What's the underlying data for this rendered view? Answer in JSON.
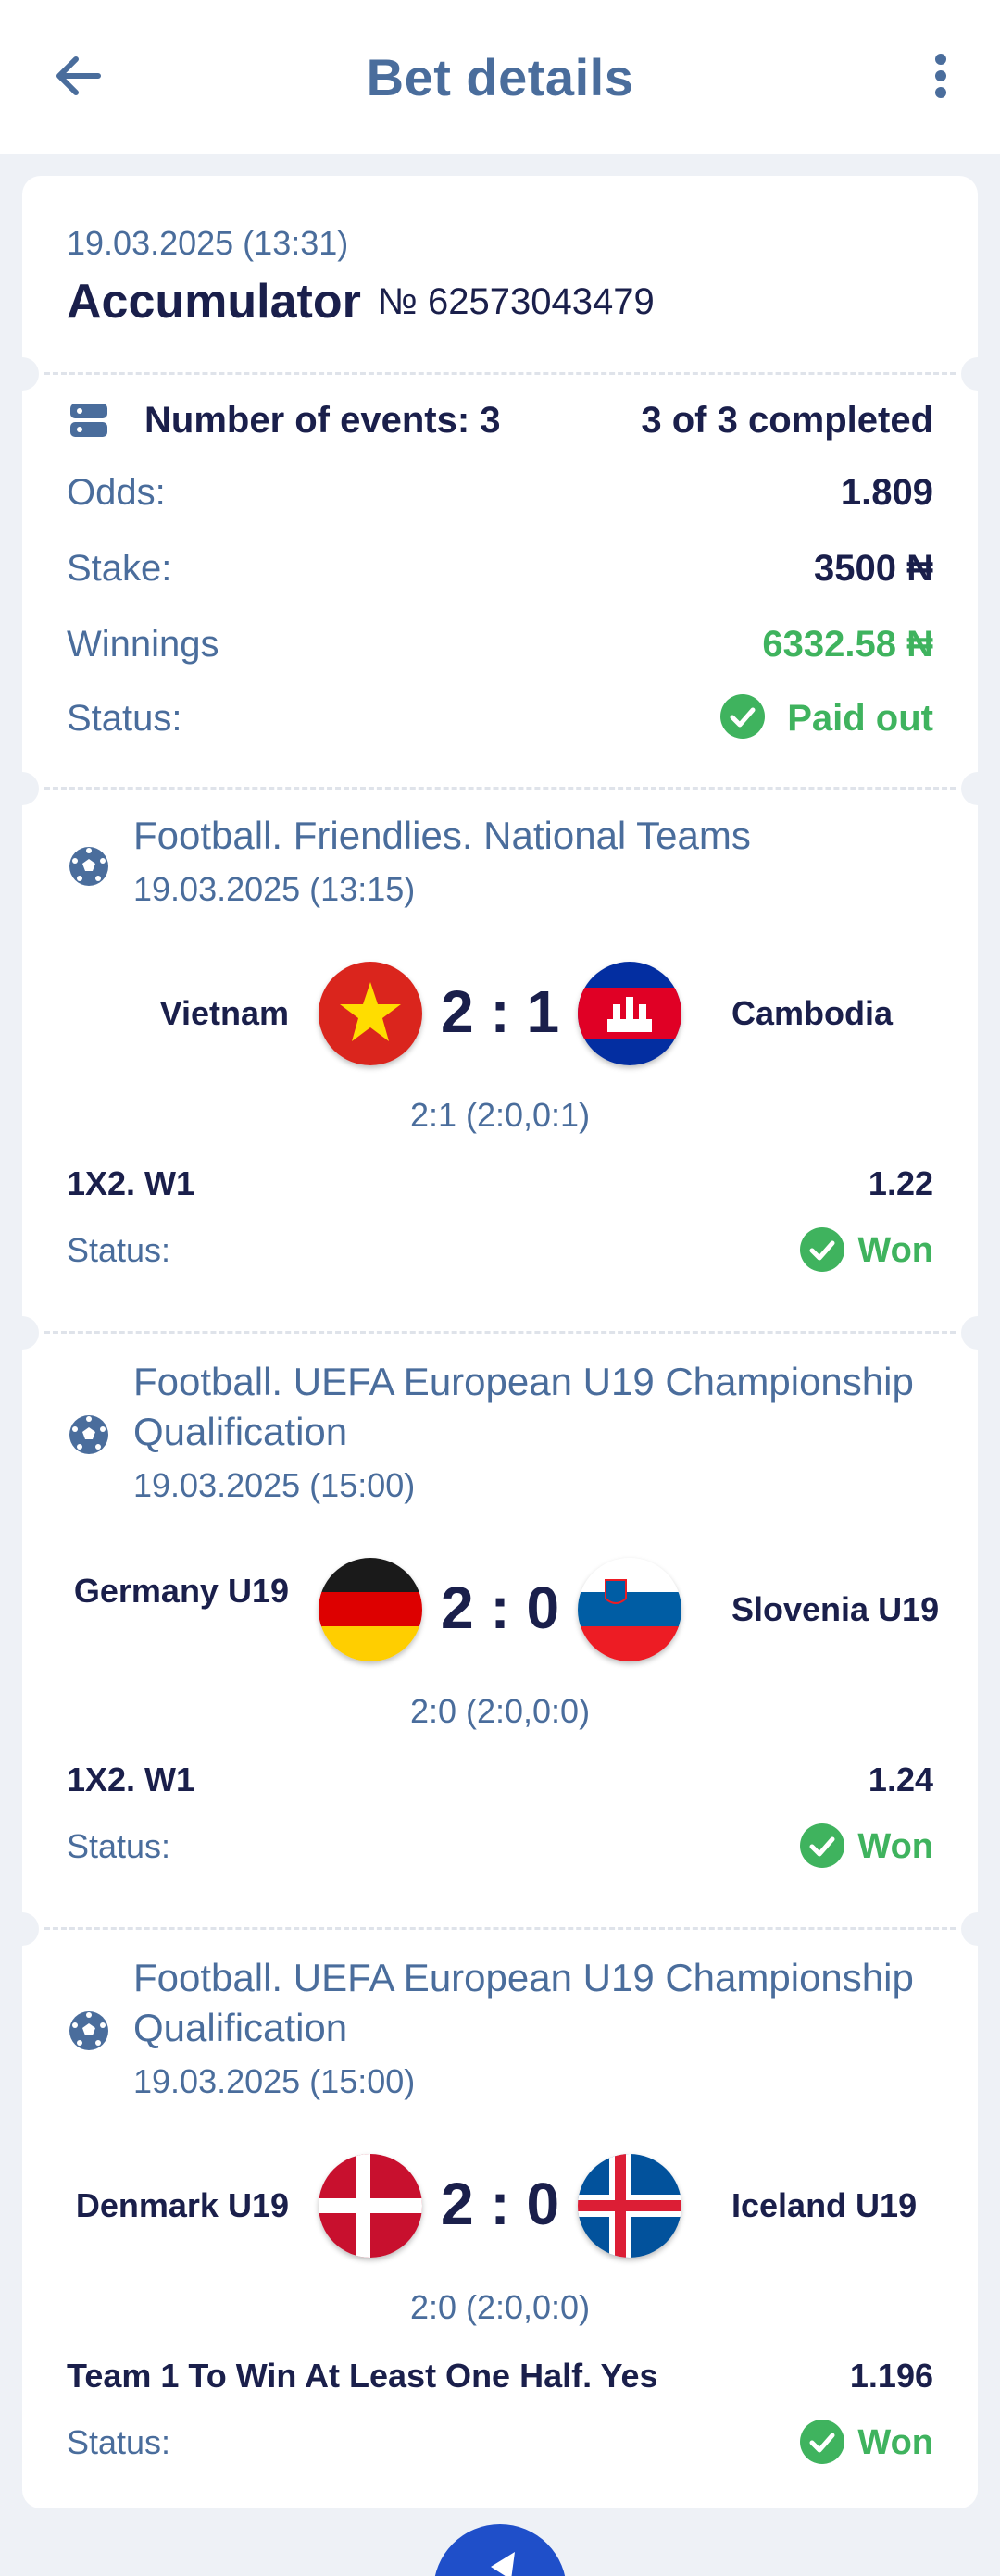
{
  "header": {
    "title": "Bet details"
  },
  "summary": {
    "date": "19.03.2025 (13:31)",
    "type": "Accumulator",
    "number": "№ 62573043479",
    "events_label": "Number of events: 3",
    "completed": "3 of 3 completed",
    "odds_label": "Odds:",
    "odds_value": "1.809",
    "stake_label": "Stake:",
    "stake_value": "3500 ₦",
    "winnings_label": "Winnings",
    "winnings_value": "6332.58 ₦",
    "status_label": "Status:",
    "status_value": "Paid out"
  },
  "events": [
    {
      "title": "Football. Friendlies. National Teams",
      "date": "19.03.2025 (13:15)",
      "team1": "Vietnam",
      "team2": "Cambodia",
      "score": "2 : 1",
      "sub_score": "2:1 (2:0,0:1)",
      "market": "1X2. W1",
      "odd": "1.22",
      "status_label": "Status:",
      "status": "Won"
    },
    {
      "title": "Football. UEFA European U19 Championship Qualification",
      "date": "19.03.2025 (15:00)",
      "team1": "Germany U19",
      "team2": "Slovenia U19",
      "score": "2 : 0",
      "sub_score": "2:0 (2:0,0:0)",
      "market": "1X2. W1",
      "odd": "1.24",
      "status_label": "Status:",
      "status": "Won"
    },
    {
      "title": "Football. UEFA European U19 Championship Qualification",
      "date": "19.03.2025 (15:00)",
      "team1": "Denmark U19",
      "team2": "Iceland U19",
      "score": "2 : 0",
      "sub_score": "2:0 (2:0,0:0)",
      "market": "Team 1 To Win At Least One Half. Yes",
      "odd": "1.196",
      "status_label": "Status:",
      "status": "Won"
    }
  ],
  "colors": {
    "accent": "#4a6d9c",
    "success": "#3fb35e",
    "dark": "#1a1f4b",
    "fab": "#1f4fc9"
  },
  "icons": [
    "back-arrow-icon",
    "more-vertical-icon",
    "events-list-icon",
    "check-circle-icon",
    "soccer-ball-icon"
  ]
}
